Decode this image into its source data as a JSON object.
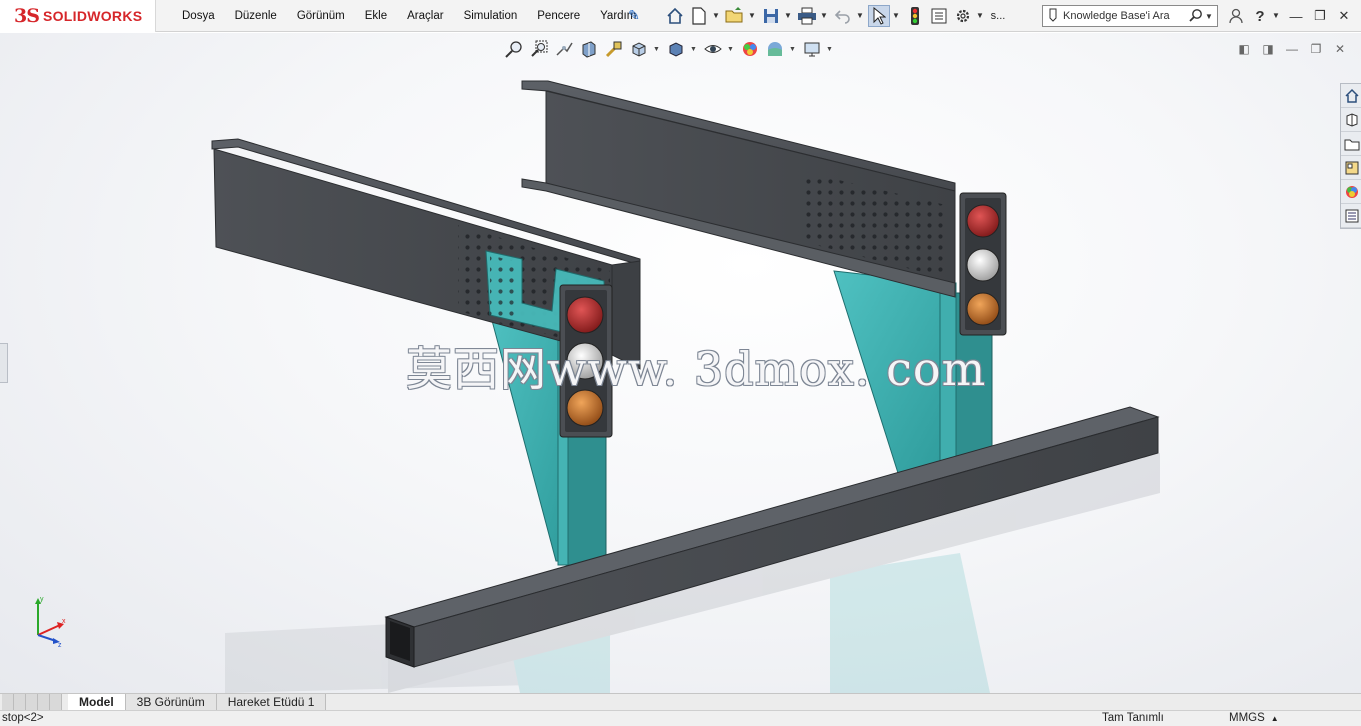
{
  "app": {
    "brand_mark": "3S",
    "brand_name": "SOLIDWORKS"
  },
  "menu": [
    "Dosya",
    "Düzenle",
    "Görünüm",
    "Ekle",
    "Araçlar",
    "Simulation",
    "Pencere",
    "Yardım"
  ],
  "toolbar": {
    "extra_label": "s..."
  },
  "search": {
    "placeholder": "Knowledge Base'i Ara"
  },
  "graphics": {
    "watermark": "莫西网www. 3dmox. com"
  },
  "tabs": [
    {
      "label": "Model",
      "active": true
    },
    {
      "label": "3B Görünüm",
      "active": false
    },
    {
      "label": "Hareket Etüdü 1",
      "active": false
    }
  ],
  "status": {
    "left": "stop<2>",
    "definition": "Tam Tanımlı",
    "units": "MMGS"
  },
  "colors": {
    "brand": "#d6262a",
    "steel": "#4a4d52",
    "bracket": "#3fb3b3",
    "lamp_red": "#b32b2b",
    "lamp_white": "#d4d4d4",
    "lamp_orange": "#d27a2c"
  }
}
